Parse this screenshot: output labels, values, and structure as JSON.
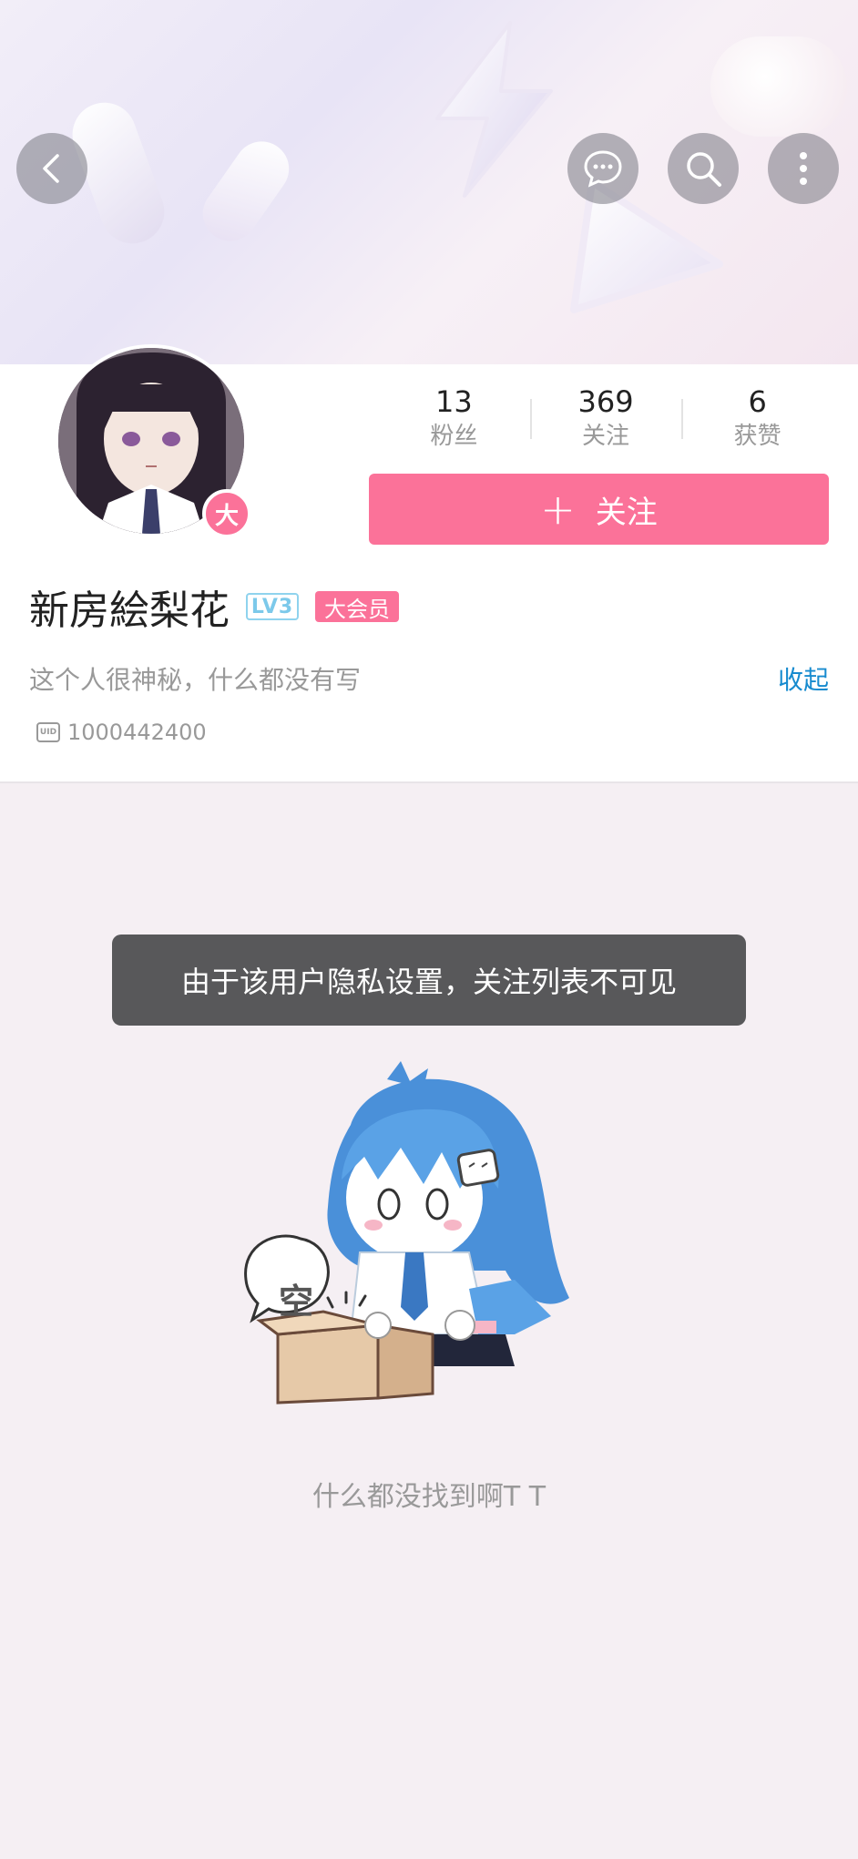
{
  "stats": [
    {
      "value": "13",
      "label": "粉丝"
    },
    {
      "value": "369",
      "label": "关注"
    },
    {
      "value": "6",
      "label": "获赞"
    }
  ],
  "follow_button": {
    "icon": "plus-icon",
    "label": "关注"
  },
  "user": {
    "avatar_badge": "大",
    "name": "新房絵梨花",
    "level": "LV3",
    "vip_tag": "大会员",
    "bio": "这个人很神秘，什么都没有写",
    "collapse_label": "收起",
    "uid_icon_text": "UID",
    "uid": "1000442400"
  },
  "toast": "由于该用户隐私设置，关注列表不可见",
  "empty_state": {
    "bubble_text": "空",
    "message": "什么都没找到啊T T"
  },
  "colors": {
    "brand_pink": "#fb7299",
    "link_blue": "#178bcf",
    "toast_bg": "#58585a"
  }
}
